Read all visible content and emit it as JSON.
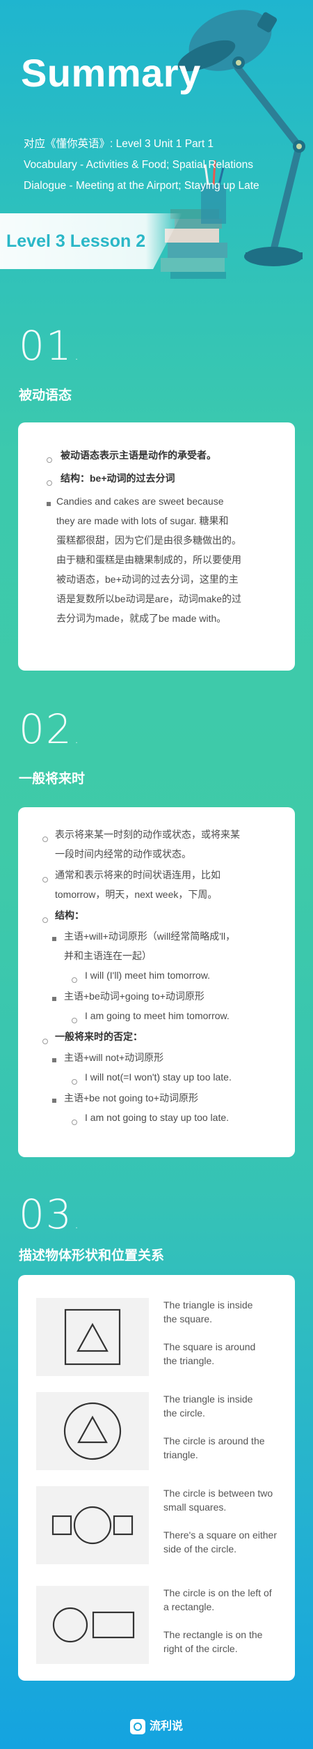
{
  "hero": {
    "title": "Summary",
    "lines": [
      "对应《懂你英语》: Level 3 Unit 1 Part 1",
      "Vocabulary - Activities & Food; Spatial Relations",
      "Dialogue - Meeting at the Airport; Staying up Late"
    ],
    "level": "Level 3 Lesson 2"
  },
  "sections": [
    {
      "number": "01",
      "title": "被动语态",
      "items": [
        "被动语态表示主语是动作的承受者。",
        "结构：be+动词的过去分词",
        "Candies and cakes are sweet because",
        "they are made with lots of sugar.  糖果和",
        "蛋糕都很甜，因为它们是由很多糖做出的。",
        "由于糖和蛋糕是由糖果制成的，所以要使用",
        "被动语态，be+动词的过去分词，这里的主",
        "语是复数所以be动词是are，动词make的过",
        "去分词为made，就成了be made with。"
      ]
    },
    {
      "number": "02",
      "title": "一般将来时",
      "items": [
        "表示将来某一时刻的动作或状态，或将来某",
        "一段时间内经常的动作或状态。",
        "通常和表示将来的时间状语连用，比如",
        "tomorrow，明天，next week，下周。",
        "结构：",
        "主语+will+动词原形（will经常简略成'll，",
        "并和主语连在一起）",
        "I will (I'll) meet him tomorrow.",
        "主语+be动词+going to+动词原形",
        "I am going to meet him tomorrow.",
        "一般将来时的否定：",
        "主语+will not+动词原形",
        "I will not(=I won't) stay up too late.",
        "主语+be not going to+动词原形",
        "I am not going to stay up too late."
      ]
    },
    {
      "number": "03",
      "title": "描述物体形状和位置关系",
      "shapes": [
        [
          "The triangle is inside",
          "the square.",
          "The square is around",
          "the triangle."
        ],
        [
          "The triangle is inside",
          "the circle.",
          "The circle is around the",
          "triangle."
        ],
        [
          "The circle is between two",
          "small squares.",
          "There's a square on either",
          "side of the circle."
        ],
        [
          "The circle is on the left of",
          "a rectangle.",
          "The rectangle is on the",
          "right of the circle."
        ]
      ]
    }
  ],
  "footer": {
    "brand": "流利说"
  },
  "colors": {
    "accent": "#2ab7c7",
    "card": "#ffffff",
    "text": "#4b4b4b"
  }
}
